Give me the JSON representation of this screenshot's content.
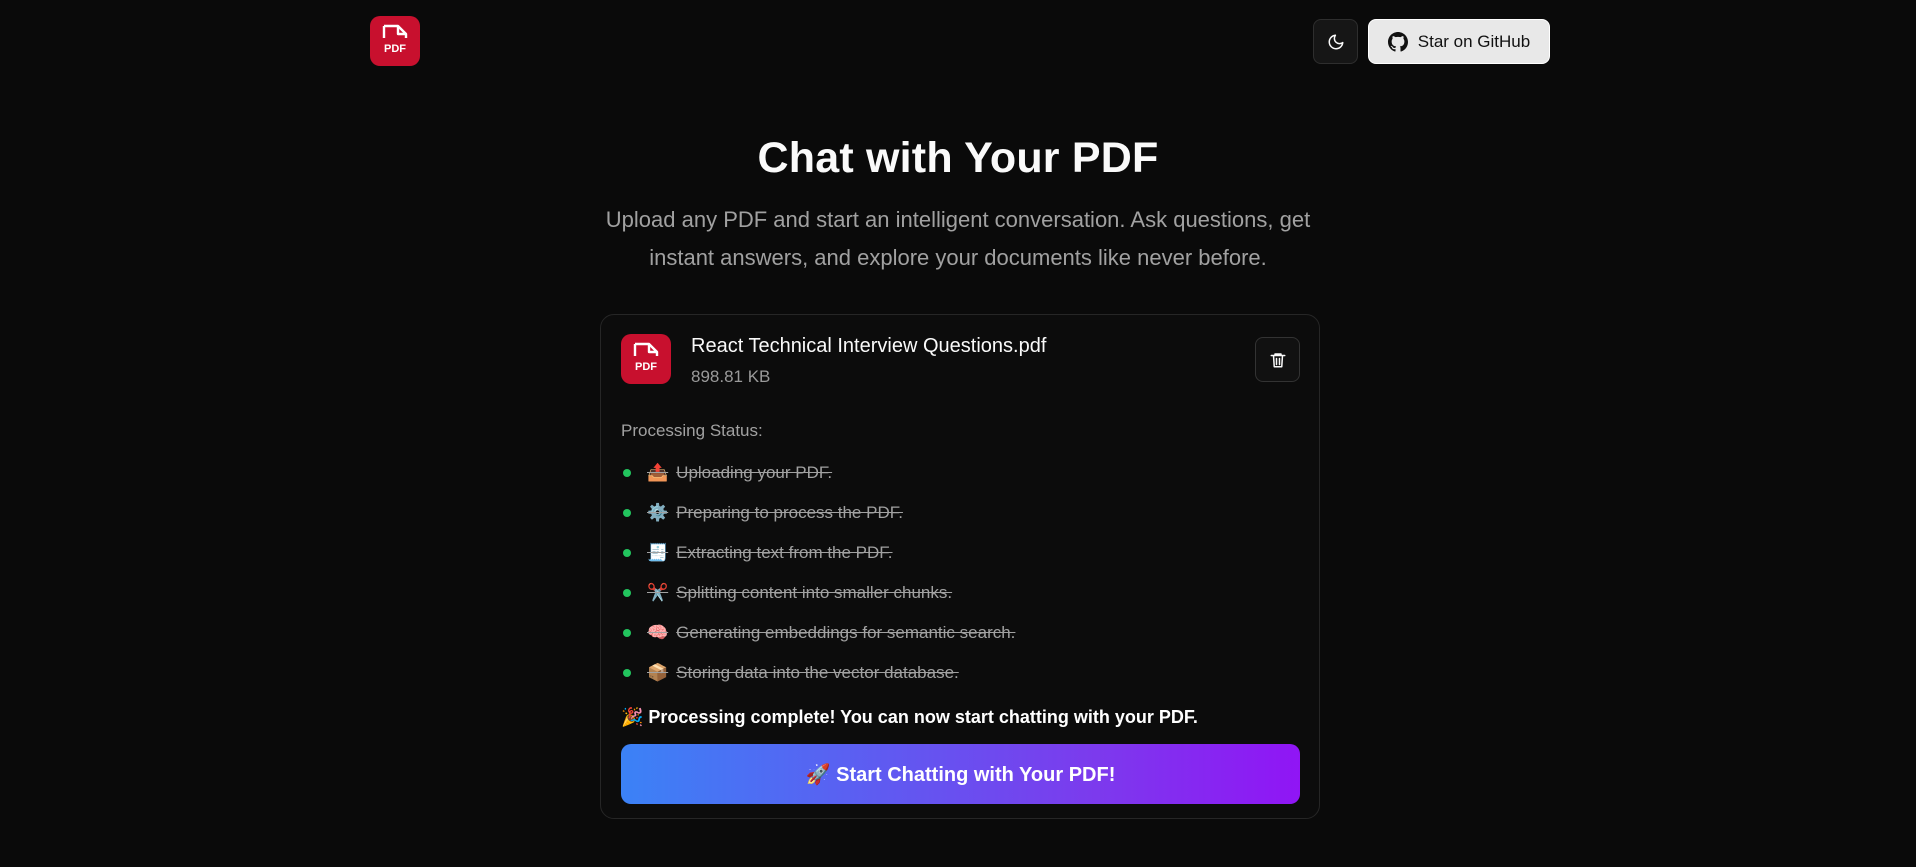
{
  "header": {
    "logo_label": "PDF",
    "github_button_label": "Star on GitHub"
  },
  "hero": {
    "title": "Chat with Your PDF",
    "subtitle": "Upload any PDF and start an intelligent conversation. Ask questions, get instant answers, and explore your documents like never before."
  },
  "file": {
    "icon_label": "PDF",
    "name": "React Technical Interview Questions.pdf",
    "size": "898.81 KB"
  },
  "processing": {
    "label": "Processing Status:",
    "steps": [
      {
        "emoji": "📤",
        "text": "Uploading your PDF."
      },
      {
        "emoji": "⚙️",
        "text": "Preparing to process the PDF."
      },
      {
        "emoji": "🧾",
        "text": "Extracting text from the PDF."
      },
      {
        "emoji": "✂️",
        "text": "Splitting content into smaller chunks."
      },
      {
        "emoji": "🧠",
        "text": "Generating embeddings for semantic search."
      },
      {
        "emoji": "📦",
        "text": "Storing data into the vector database."
      }
    ],
    "complete_message": "🎉 Processing complete! You can now start chatting with your PDF."
  },
  "cta": {
    "label": "🚀 Start Chatting with Your PDF!"
  },
  "colors": {
    "background": "#0a0a0a",
    "pdf_red": "#c8102e",
    "status_green": "#22c55e",
    "gradient_start": "#3b82f6",
    "gradient_end": "#9015f5"
  }
}
